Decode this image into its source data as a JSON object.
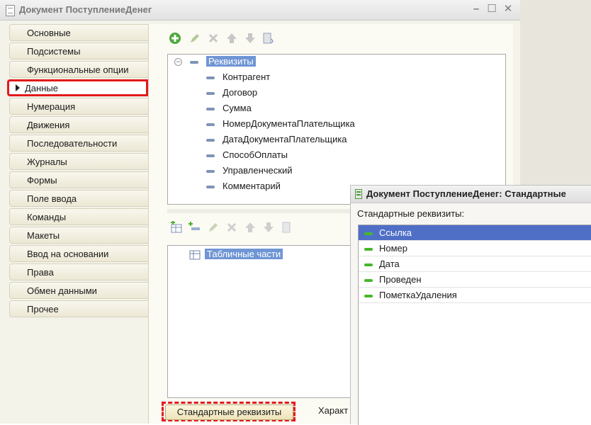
{
  "main_window": {
    "title": "Документ ПоступлениеДенег",
    "controls": {
      "minimize": "–",
      "maximize": "☐",
      "close": "✕"
    }
  },
  "nav": {
    "items": [
      {
        "label": "Основные"
      },
      {
        "label": "Подсистемы"
      },
      {
        "label": "Функциональные опции"
      },
      {
        "label": "Данные"
      },
      {
        "label": "Нумерация"
      },
      {
        "label": "Движения"
      },
      {
        "label": "Последовательности"
      },
      {
        "label": "Журналы"
      },
      {
        "label": "Формы"
      },
      {
        "label": "Поле ввода"
      },
      {
        "label": "Команды"
      },
      {
        "label": "Макеты"
      },
      {
        "label": "Ввод на основании"
      },
      {
        "label": "Права"
      },
      {
        "label": "Обмен данными"
      },
      {
        "label": "Прочее"
      }
    ],
    "active_item": "Данные"
  },
  "attributes": {
    "root": "Реквизиты",
    "items": [
      "Контрагент",
      "Договор",
      "Сумма",
      "НомерДокументаПлательщика",
      "ДатаДокументаПлательщика",
      "СпособОплаты",
      "Управленческий",
      "Комментарий"
    ]
  },
  "tabular_parts": {
    "root": "Табличные части"
  },
  "buttons": {
    "standard_attributes": "Стандартные реквизиты",
    "characteristics": "Характ"
  },
  "popup": {
    "title": "Документ ПоступлениеДенег: Стандартные",
    "label": "Стандартные реквизиты:",
    "items": [
      "Ссылка",
      "Номер",
      "Дата",
      "Проведен",
      "ПометкаУдаления"
    ],
    "selected": "Ссылка"
  },
  "colors": {
    "highlight_red": "#e21a1a",
    "selection_blue": "#4f6fc7",
    "tree_selection": "#6f95d4",
    "panel_bg": "#fbfaf3"
  }
}
